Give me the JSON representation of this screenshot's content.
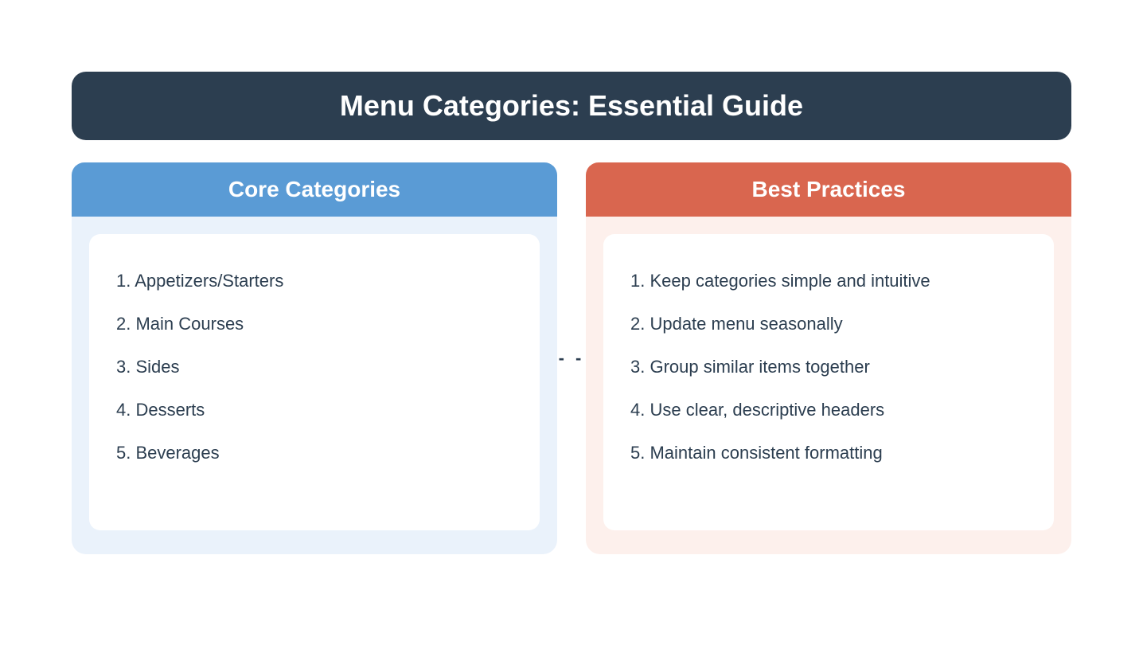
{
  "title": "Menu Categories: Essential Guide",
  "left": {
    "header": "Core Categories",
    "items": [
      "1. Appetizers/Starters",
      "2. Main Courses",
      "3. Sides",
      "4. Desserts",
      "5. Beverages"
    ]
  },
  "right": {
    "header": "Best Practices",
    "items": [
      "1. Keep categories simple and intuitive",
      "2. Update menu seasonally",
      "3. Group similar items together",
      "4. Use clear, descriptive headers",
      "5. Maintain consistent formatting"
    ]
  },
  "connector": "- -"
}
